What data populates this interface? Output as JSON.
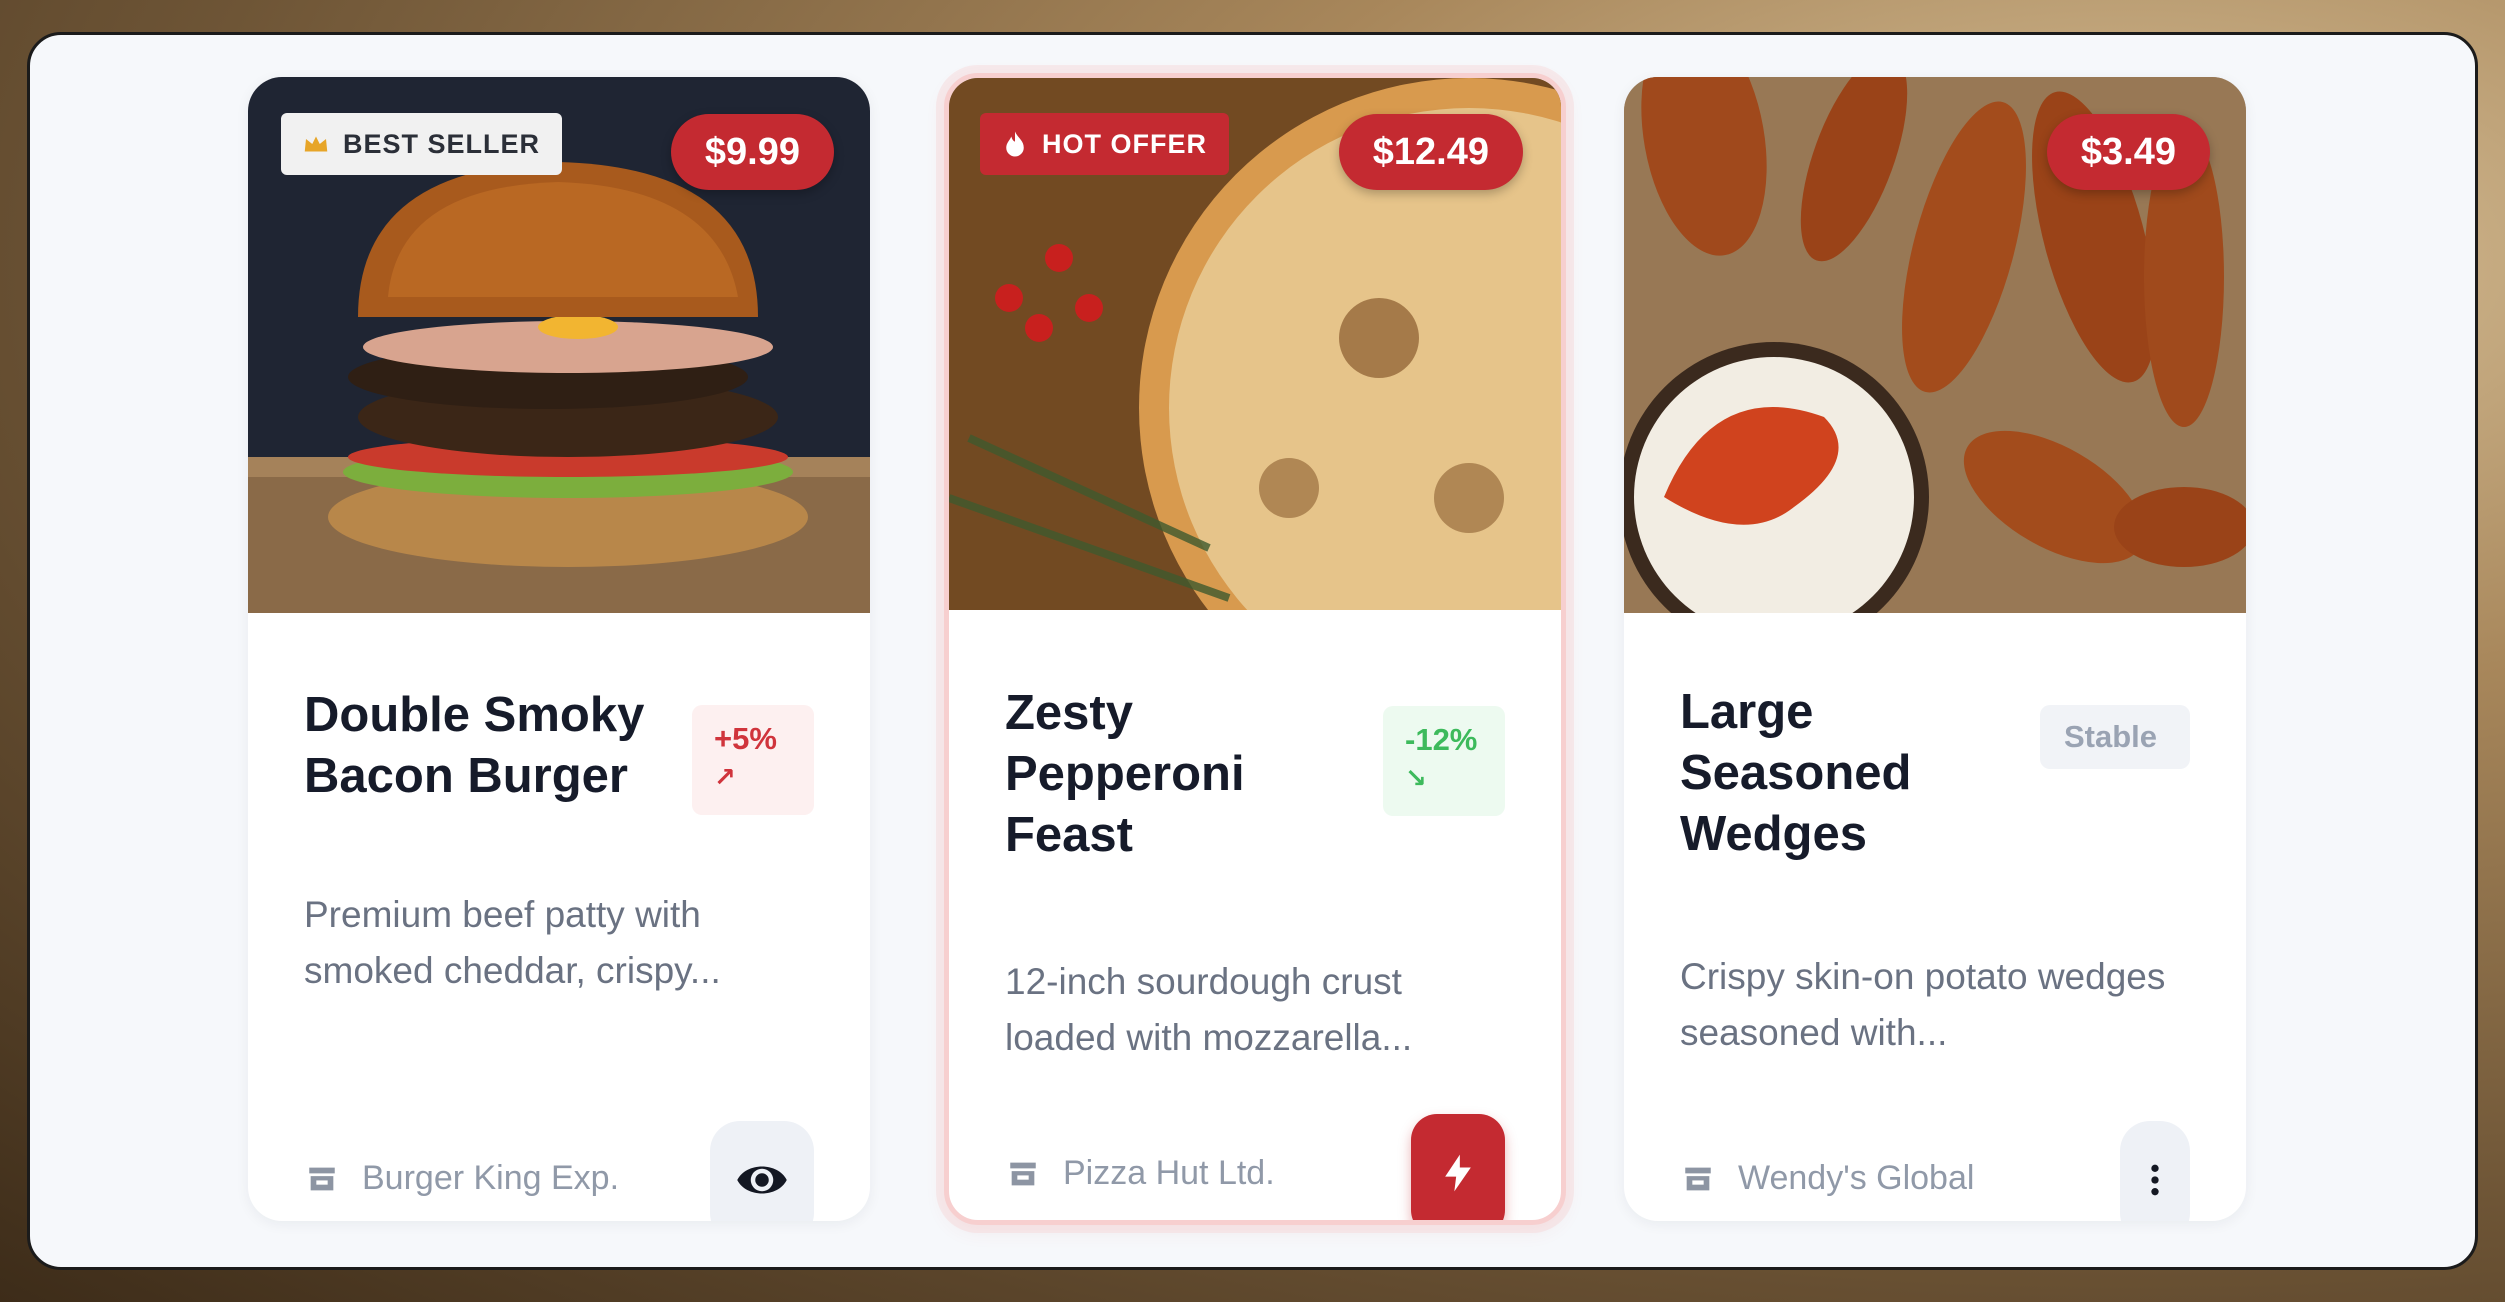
{
  "colors": {
    "accent_red": "#c42a31",
    "up_red": "#d0343c",
    "down_green": "#3dba5c",
    "stable_gray": "#9aa3b3"
  },
  "cards": [
    {
      "tag_label": "BEST SELLER",
      "tag_icon": "crown-icon",
      "price": "$9.99",
      "title": "Double Smoky Bacon Burger",
      "trend_value": "+5%",
      "trend_arrow": "↗",
      "description": "Premium beef patty with smoked cheddar, crispy...",
      "vendor": "Burger King Exp.",
      "action_icon": "eye-icon"
    },
    {
      "tag_label": "HOT OFFER",
      "tag_icon": "flame-icon",
      "price": "$12.49",
      "title": "Zesty Pepperoni Feast",
      "trend_value": "-12%",
      "trend_arrow": "↘",
      "description": "12-inch sourdough crust loaded with mozzarella...",
      "vendor": "Pizza Hut Ltd.",
      "action_icon": "lightning-icon"
    },
    {
      "price": "$3.49",
      "title": "Large Seasoned Wedges",
      "trend_value": "Stable",
      "description": "Crispy skin-on potato wedges seasoned with...",
      "vendor": "Wendy's Global",
      "action_icon": "more-vertical-icon"
    }
  ]
}
